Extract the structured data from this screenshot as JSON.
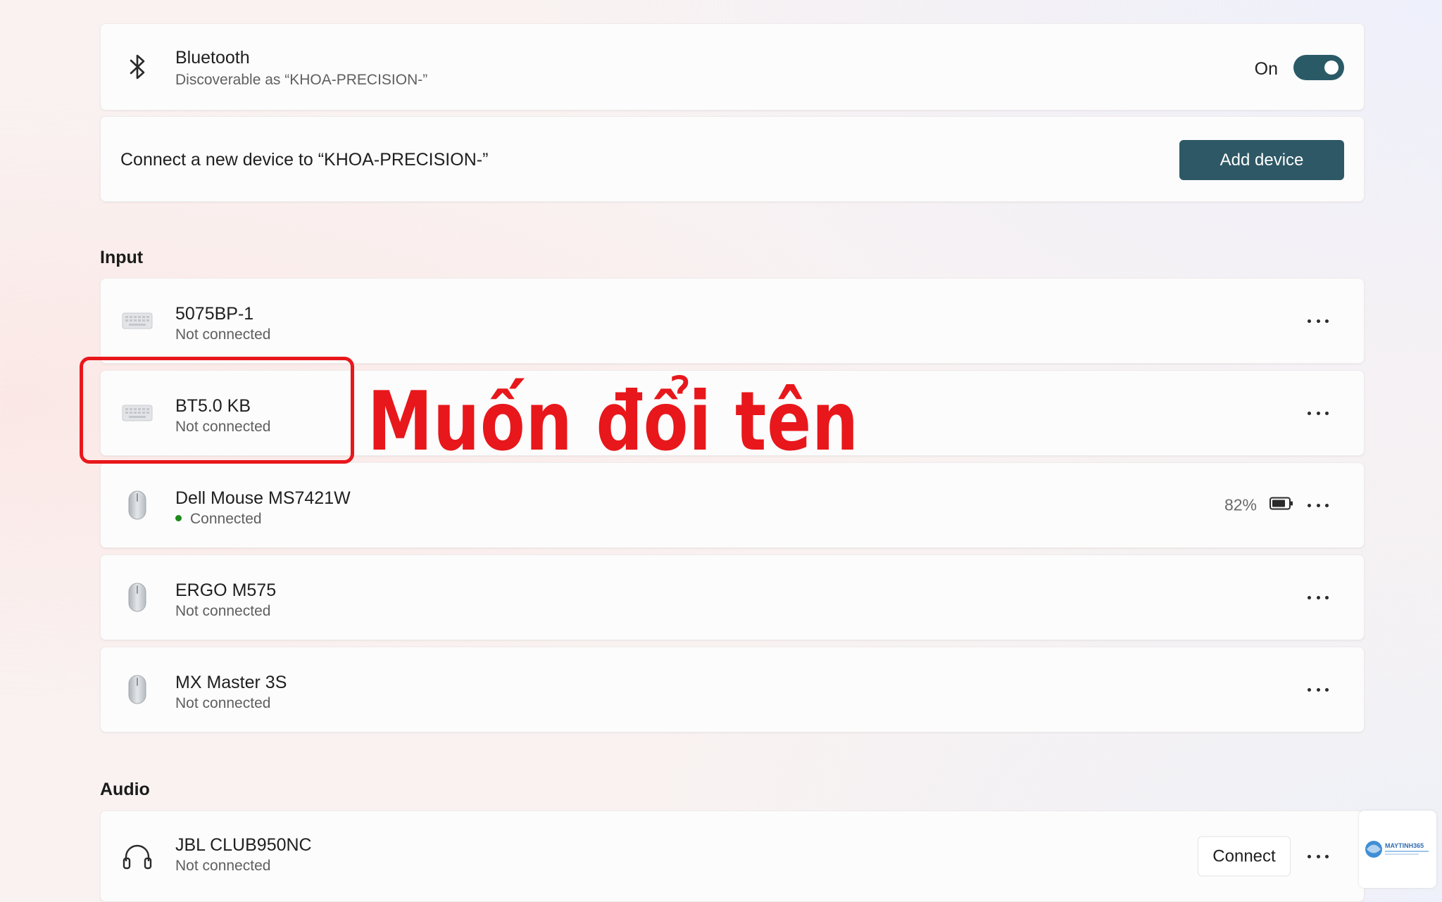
{
  "bluetooth": {
    "title": "Bluetooth",
    "subtitle": "Discoverable as “KHOA-PRECISION-”",
    "toggle_label": "On",
    "toggle_on": true
  },
  "add_device": {
    "text": "Connect a new device to “KHOA-PRECISION-”",
    "button_label": "Add device"
  },
  "sections": {
    "input_label": "Input",
    "audio_label": "Audio"
  },
  "input_devices": [
    {
      "name": "5075BP-1",
      "status": "Not connected",
      "icon": "keyboard-icon"
    },
    {
      "name": "BT5.0 KB",
      "status": "Not connected",
      "icon": "keyboard-icon"
    },
    {
      "name": "Dell Mouse MS7421W",
      "status": "Connected",
      "icon": "mouse-icon",
      "battery": "82%",
      "battery_level": 0.82
    },
    {
      "name": "ERGO M575",
      "status": "Not connected",
      "icon": "mouse-icon"
    },
    {
      "name": "MX Master 3S",
      "status": "Not connected",
      "icon": "mouse-icon"
    }
  ],
  "audio_devices": [
    {
      "name": "JBL CLUB950NC",
      "status": "Not connected",
      "icon": "headphones-icon",
      "connect_label": "Connect"
    }
  ],
  "annotation": {
    "text": "Muốn đổi tên"
  },
  "watermark": {
    "brand": "MAYTINH365"
  },
  "colors": {
    "accent": "#2e5865",
    "annotation": "#e8171b",
    "connected_dot": "#1c8a1c"
  }
}
